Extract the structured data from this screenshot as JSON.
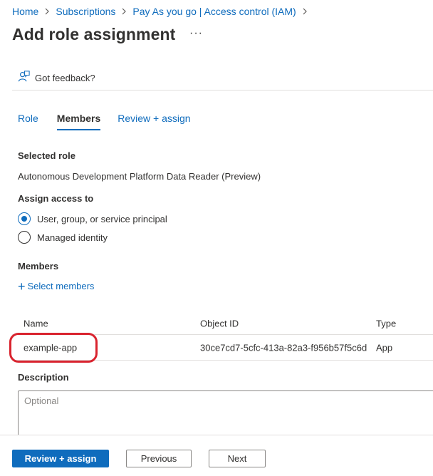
{
  "breadcrumb": [
    "Home",
    "Subscriptions",
    "Pay As you go | Access control (IAM)"
  ],
  "page": {
    "title": "Add role assignment",
    "more": "···"
  },
  "feedback": {
    "label": "Got feedback?"
  },
  "tabs": [
    "Role",
    "Members",
    "Review + assign"
  ],
  "active_tab": "Members",
  "selected_role": {
    "heading": "Selected role",
    "value": "Autonomous Development Platform Data Reader (Preview)"
  },
  "assign_access": {
    "heading": "Assign access to",
    "options": [
      "User, group, or service principal",
      "Managed identity"
    ],
    "selected": "User, group, or service principal"
  },
  "members": {
    "heading": "Members",
    "select_label": "Select members",
    "columns": [
      "Name",
      "Object ID",
      "Type"
    ],
    "rows": [
      {
        "name": "example-app",
        "object_id": "30ce7cd7-5cfc-413a-82a3-f956b57f5c6d",
        "type": "App"
      }
    ]
  },
  "description": {
    "heading": "Description",
    "placeholder": "Optional"
  },
  "footer": {
    "primary": "Review + assign",
    "previous": "Previous",
    "next": "Next"
  },
  "colors": {
    "accent": "#0f6cbd",
    "highlight": "#d9232e"
  }
}
